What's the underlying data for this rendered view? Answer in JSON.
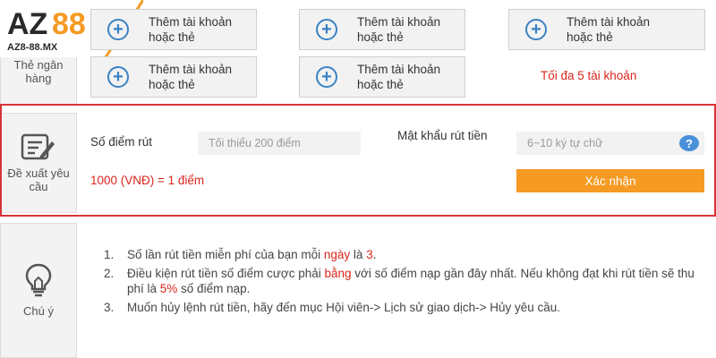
{
  "logo": {
    "brand": "AZ88",
    "domain": "AZ8-88.MX",
    "colors": {
      "accent": "#f59a23",
      "text": "#2a2a2a"
    }
  },
  "bank_section": {
    "label": "Thẻ ngân hàng",
    "add_buttons": [
      {
        "label": "Thêm tài khoản hoặc thẻ"
      },
      {
        "label": "Thêm tài khoản hoặc thẻ"
      },
      {
        "label": "Thêm tài khoản hoặc thẻ"
      },
      {
        "label": "Thêm tài khoản hoặc thẻ"
      },
      {
        "label": "Thêm tài khoản hoặc thẻ"
      }
    ],
    "max_note": "Tối đa 5 tài khoản"
  },
  "withdraw": {
    "side_label": "Đề xuất yêu cầu",
    "points_label": "Số điểm rút",
    "points_placeholder": "Tối thiểu 200 điểm",
    "password_label": "Mật khẩu rút tiền",
    "password_placeholder": "6~10 ký tự chữ",
    "help": "?",
    "rate": "1000 (VNĐ) = 1 điểm",
    "confirm": "Xác nhận"
  },
  "notes": {
    "side_label": "Chú ý",
    "items": [
      {
        "num": "1.",
        "a": "Số lần rút tiền miễn phí của bạn mỗi ",
        "hl1": "ngày",
        "b": " là ",
        "hl2": "3",
        "c": "."
      },
      {
        "num": "2.",
        "a": "Điều kiện rút tiền số điểm cược phải ",
        "hl1": "bằng",
        "b": " với số điểm nạp gần đây nhất. Nếu không đạt khi rút tiền sẽ thu phí là ",
        "hl2": "5%",
        "c": " số điểm nạp."
      },
      {
        "num": "3.",
        "a": "Muốn hủy lệnh rút tiền, hãy đến mục Hội viên-> Lịch sử giao dịch-> Hủy yêu cầu.",
        "hl1": "",
        "b": "",
        "hl2": "",
        "c": ""
      }
    ]
  },
  "colors": {
    "highlight_border": "#d9343a",
    "red_text": "#d9261c",
    "confirm_bg": "#f59a23",
    "plus_icon": "#3b82c4"
  }
}
